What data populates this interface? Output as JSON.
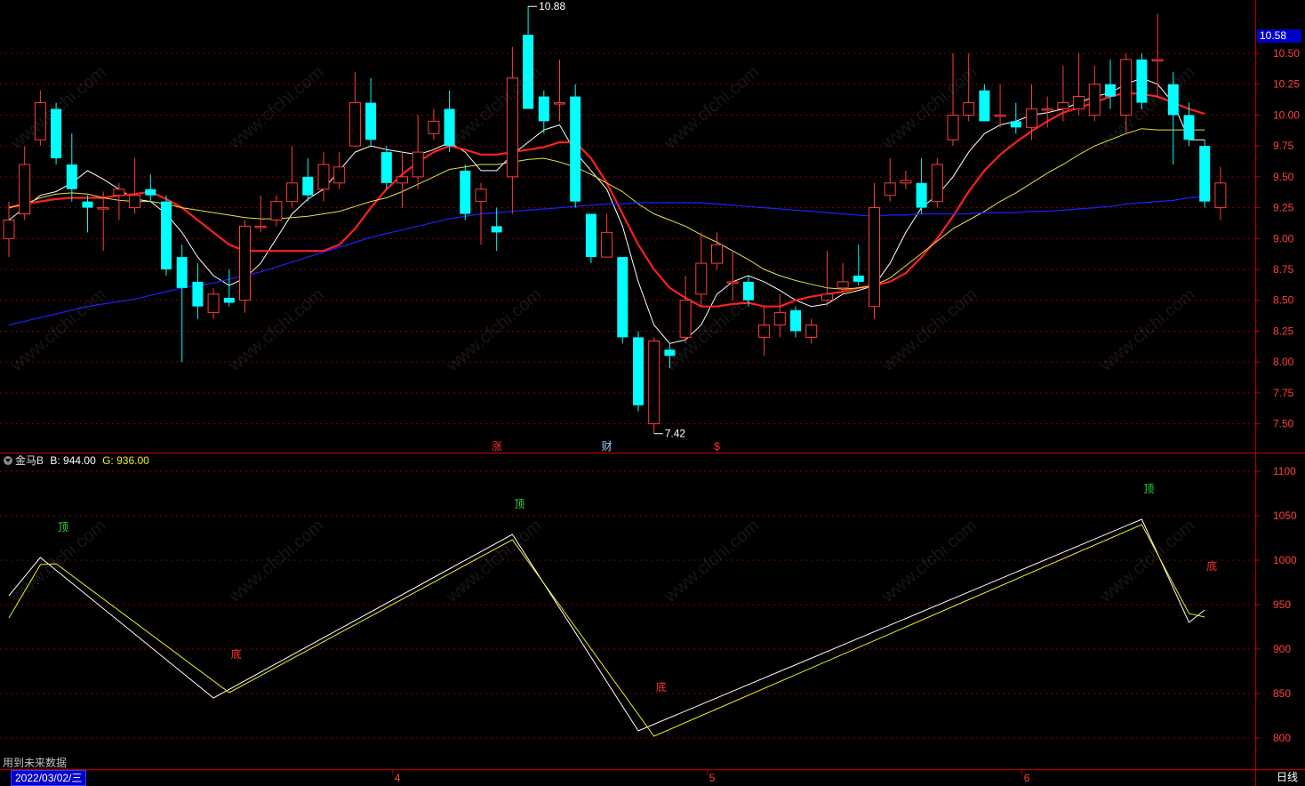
{
  "window": {
    "period_label": "日线",
    "footnote": "用到未来数据",
    "current_date": "2022/03/02/三"
  },
  "colors": {
    "up": "#ff3b3b",
    "down": "#00ffff",
    "ma5": "#ffffff",
    "ma10": "#ff2020",
    "ma20": "#e8e040",
    "ma60": "#2020ff",
    "grid": "#8b0000",
    "axis_text": "#ff4040"
  },
  "price_panel": {
    "axis_ticks": [
      "10.50",
      "10.25",
      "10.00",
      "9.75",
      "9.50",
      "9.25",
      "9.00",
      "8.75",
      "8.50",
      "8.25",
      "8.00",
      "7.75",
      "7.50"
    ],
    "last_price": "10.58",
    "high_label": "10.88",
    "low_label": "7.42",
    "event_marks": [
      {
        "text": "涨",
        "index": 31
      },
      {
        "text": "财",
        "index": 38
      },
      {
        "text": "$",
        "index": 45
      }
    ]
  },
  "indicator_panel": {
    "name": "金马B",
    "b_label": "B:",
    "b_value": "944.00",
    "g_label": "G:",
    "g_value": "936.00",
    "axis_ticks": [
      "1100",
      "1050",
      "1000",
      "950",
      "900",
      "850",
      "800"
    ],
    "signals": [
      {
        "text": "顶",
        "type": "top",
        "index": 3
      },
      {
        "text": "底",
        "type": "bottom",
        "index": 14
      },
      {
        "text": "顶",
        "type": "top",
        "index": 32
      },
      {
        "text": "底",
        "type": "bottom",
        "index": 41
      },
      {
        "text": "顶",
        "type": "top",
        "index": 72
      },
      {
        "text": "底",
        "type": "bottom",
        "index": 76
      }
    ]
  },
  "time_axis": {
    "labels": [
      {
        "text": "4",
        "index": 24
      },
      {
        "text": "5",
        "index": 44
      },
      {
        "text": "6",
        "index": 64
      }
    ]
  },
  "watermark": "www.cfchi.com",
  "chart_data": {
    "type": "candlestick",
    "ylim": [
      7.3,
      10.92
    ],
    "candles": [
      [
        9.0,
        9.15,
        9.3,
        8.85
      ],
      [
        9.2,
        9.6,
        9.75,
        9.15
      ],
      [
        9.8,
        10.1,
        10.2,
        9.75
      ],
      [
        10.05,
        9.65,
        10.1,
        9.6
      ],
      [
        9.6,
        9.4,
        9.85,
        9.3
      ],
      [
        9.3,
        9.25,
        9.35,
        9.05
      ],
      [
        9.25,
        9.25,
        9.38,
        8.9
      ],
      [
        9.35,
        9.4,
        9.45,
        9.15
      ],
      [
        9.25,
        9.35,
        9.65,
        9.2
      ],
      [
        9.4,
        9.35,
        9.52,
        9.3
      ],
      [
        9.3,
        8.75,
        9.35,
        8.7
      ],
      [
        8.85,
        8.6,
        8.95,
        8.0
      ],
      [
        8.65,
        8.45,
        8.8,
        8.35
      ],
      [
        8.4,
        8.55,
        8.6,
        8.35
      ],
      [
        8.52,
        8.48,
        8.75,
        8.45
      ],
      [
        8.5,
        9.1,
        9.15,
        8.4
      ],
      [
        9.1,
        9.1,
        9.35,
        9.05
      ],
      [
        9.15,
        9.3,
        9.35,
        9.1
      ],
      [
        9.3,
        9.45,
        9.75,
        9.25
      ],
      [
        9.5,
        9.35,
        9.65,
        9.3
      ],
      [
        9.4,
        9.6,
        9.7,
        9.3
      ],
      [
        9.45,
        9.58,
        9.7,
        9.4
      ],
      [
        9.75,
        10.1,
        10.35,
        9.8
      ],
      [
        10.1,
        9.8,
        10.3,
        9.75
      ],
      [
        9.7,
        9.45,
        9.75,
        9.4
      ],
      [
        9.45,
        9.5,
        9.7,
        9.25
      ],
      [
        9.5,
        9.7,
        10.0,
        9.4
      ],
      [
        9.85,
        9.95,
        10.05,
        9.8
      ],
      [
        10.05,
        9.75,
        10.2,
        9.7
      ],
      [
        9.55,
        9.2,
        9.6,
        9.15
      ],
      [
        9.3,
        9.4,
        9.45,
        8.95
      ],
      [
        9.1,
        9.05,
        9.25,
        8.9
      ],
      [
        9.5,
        10.3,
        10.55,
        9.2
      ],
      [
        10.65,
        10.05,
        10.88,
        10.05
      ],
      [
        10.15,
        9.95,
        10.2,
        9.85
      ],
      [
        10.1,
        10.1,
        10.45,
        9.95
      ],
      [
        10.15,
        9.3,
        10.25,
        9.25
      ],
      [
        9.2,
        8.85,
        9.2,
        8.8
      ],
      [
        8.85,
        9.05,
        9.2,
        8.85
      ],
      [
        8.85,
        8.2,
        8.85,
        8.15
      ],
      [
        8.2,
        7.65,
        8.25,
        7.6
      ],
      [
        7.5,
        8.17,
        8.2,
        7.42
      ],
      [
        8.1,
        8.05,
        8.15,
        7.95
      ],
      [
        8.2,
        8.5,
        8.7,
        8.15
      ],
      [
        8.55,
        8.8,
        9.05,
        8.45
      ],
      [
        8.8,
        8.95,
        9.05,
        8.75
      ],
      [
        8.65,
        8.65,
        8.9,
        8.5
      ],
      [
        8.65,
        8.5,
        8.7,
        8.45
      ],
      [
        8.2,
        8.3,
        8.45,
        8.05
      ],
      [
        8.3,
        8.4,
        8.55,
        8.2
      ],
      [
        8.42,
        8.25,
        8.45,
        8.2
      ],
      [
        8.2,
        8.3,
        8.35,
        8.15
      ],
      [
        8.5,
        8.55,
        8.9,
        8.45
      ],
      [
        8.6,
        8.65,
        8.8,
        8.55
      ],
      [
        8.7,
        8.65,
        8.95,
        8.62
      ],
      [
        8.45,
        9.25,
        9.45,
        8.35
      ],
      [
        9.35,
        9.45,
        9.65,
        9.3
      ],
      [
        9.45,
        9.47,
        9.55,
        9.4
      ],
      [
        9.45,
        9.25,
        9.65,
        9.2
      ],
      [
        9.3,
        9.6,
        9.65,
        9.25
      ],
      [
        9.8,
        10.0,
        10.5,
        9.75
      ],
      [
        10.0,
        10.1,
        10.5,
        9.95
      ],
      [
        10.2,
        9.95,
        10.25,
        9.95
      ],
      [
        10.0,
        10.0,
        10.25,
        9.9
      ],
      [
        9.95,
        9.9,
        10.1,
        9.85
      ],
      [
        9.9,
        10.05,
        10.25,
        9.8
      ],
      [
        10.05,
        10.05,
        10.15,
        9.9
      ],
      [
        10.05,
        10.1,
        10.4,
        9.95
      ],
      [
        10.05,
        10.15,
        10.5,
        10.0
      ],
      [
        10.0,
        10.25,
        10.4,
        9.95
      ],
      [
        10.25,
        10.15,
        10.45,
        10.05
      ],
      [
        10.0,
        10.45,
        10.5,
        9.85
      ],
      [
        10.45,
        10.1,
        10.5,
        10.05
      ],
      [
        10.45,
        10.45,
        10.82,
        10.15
      ],
      [
        10.25,
        10.0,
        10.35,
        9.6
      ],
      [
        10.0,
        9.8,
        10.1,
        9.75
      ],
      [
        9.75,
        9.3,
        9.8,
        9.25
      ],
      [
        9.25,
        9.45,
        9.58,
        9.15
      ]
    ],
    "series": [
      {
        "name": "MA5",
        "values": [
          9.15,
          9.25,
          9.35,
          9.38,
          9.45,
          9.55,
          9.48,
          9.4,
          9.32,
          9.3,
          9.2,
          9.05,
          8.85,
          8.7,
          8.62,
          8.68,
          8.8,
          9.0,
          9.2,
          9.32,
          9.4,
          9.55,
          9.7,
          9.75,
          9.72,
          9.7,
          9.68,
          9.72,
          9.78,
          9.7,
          9.55,
          9.55,
          9.68,
          9.78,
          9.88,
          9.92,
          9.7,
          9.55,
          9.4,
          9.1,
          8.65,
          8.3,
          8.15,
          8.18,
          8.3,
          8.55,
          8.65,
          8.7,
          8.65,
          8.58,
          8.5,
          8.45,
          8.47,
          8.55,
          8.58,
          8.62,
          8.8,
          9.05,
          9.25,
          9.35,
          9.5,
          9.7,
          9.85,
          9.92,
          9.95,
          10.0,
          10.02,
          10.05,
          10.1,
          10.15,
          10.18,
          10.25,
          10.3,
          10.25,
          10.1,
          9.8,
          9.8
        ]
      },
      {
        "name": "MA10",
        "values": [
          9.25,
          9.28,
          9.3,
          9.32,
          9.33,
          9.33,
          9.33,
          9.35,
          9.36,
          9.38,
          9.32,
          9.25,
          9.15,
          9.05,
          8.95,
          8.9,
          8.9,
          8.9,
          8.9,
          8.9,
          8.9,
          8.95,
          9.08,
          9.25,
          9.4,
          9.52,
          9.62,
          9.7,
          9.75,
          9.72,
          9.68,
          9.68,
          9.7,
          9.72,
          9.74,
          9.78,
          9.78,
          9.65,
          9.45,
          9.2,
          8.95,
          8.75,
          8.6,
          8.52,
          8.45,
          8.45,
          8.47,
          8.48,
          8.45,
          8.45,
          8.5,
          8.53,
          8.55,
          8.57,
          8.6,
          8.62,
          8.65,
          8.72,
          8.85,
          9.0,
          9.18,
          9.38,
          9.55,
          9.68,
          9.78,
          9.87,
          9.95,
          10.02,
          10.06,
          10.1,
          10.15,
          10.18,
          10.17,
          10.15,
          10.1,
          10.05,
          10.01
        ]
      },
      {
        "name": "MA20",
        "values": [
          9.25,
          9.28,
          9.33,
          9.36,
          9.37,
          9.36,
          9.33,
          9.31,
          9.3,
          9.3,
          9.28,
          9.25,
          9.23,
          9.21,
          9.19,
          9.17,
          9.16,
          9.16,
          9.17,
          9.18,
          9.2,
          9.22,
          9.26,
          9.3,
          9.33,
          9.38,
          9.44,
          9.5,
          9.56,
          9.58,
          9.6,
          9.6,
          9.62,
          9.64,
          9.65,
          9.62,
          9.58,
          9.52,
          9.45,
          9.38,
          9.28,
          9.2,
          9.15,
          9.1,
          9.03,
          8.97,
          8.9,
          8.83,
          8.75,
          8.7,
          8.66,
          8.63,
          8.6,
          8.59,
          8.6,
          8.62,
          8.68,
          8.78,
          8.88,
          8.98,
          9.08,
          9.15,
          9.22,
          9.3,
          9.37,
          9.45,
          9.53,
          9.6,
          9.68,
          9.75,
          9.8,
          9.85,
          9.89,
          9.88,
          9.88,
          9.88,
          9.88
        ]
      },
      {
        "name": "MA60",
        "values": [
          8.3,
          8.33,
          8.36,
          8.39,
          8.42,
          8.45,
          8.47,
          8.49,
          8.51,
          8.54,
          8.57,
          8.6,
          8.62,
          8.64,
          8.67,
          8.7,
          8.73,
          8.77,
          8.81,
          8.85,
          8.89,
          8.93,
          8.97,
          9.01,
          9.04,
          9.07,
          9.1,
          9.13,
          9.16,
          9.18,
          9.2,
          9.21,
          9.22,
          9.23,
          9.24,
          9.25,
          9.26,
          9.27,
          9.28,
          9.28,
          9.29,
          9.29,
          9.29,
          9.29,
          9.29,
          9.28,
          9.27,
          9.26,
          9.25,
          9.24,
          9.23,
          9.22,
          9.21,
          9.2,
          9.19,
          9.18,
          9.19,
          9.19,
          9.2,
          9.2,
          9.2,
          9.2,
          9.21,
          9.21,
          9.21,
          9.22,
          9.22,
          9.23,
          9.24,
          9.25,
          9.26,
          9.28,
          9.29,
          9.3,
          9.31,
          9.33,
          9.34
        ]
      }
    ],
    "indicator": {
      "ylim": [
        780,
        1120
      ],
      "B": [
        [
          0,
          960
        ],
        [
          2,
          1003
        ],
        [
          13,
          845
        ],
        [
          32,
          1029
        ],
        [
          40,
          808
        ],
        [
          72,
          1046
        ],
        [
          75,
          930
        ],
        [
          76,
          944
        ]
      ],
      "G": [
        [
          0,
          935
        ],
        [
          2,
          995
        ],
        [
          3,
          996
        ],
        [
          14,
          851
        ],
        [
          32,
          1023
        ],
        [
          41,
          802
        ],
        [
          72,
          1040
        ],
        [
          75,
          940
        ],
        [
          76,
          936
        ]
      ]
    }
  }
}
